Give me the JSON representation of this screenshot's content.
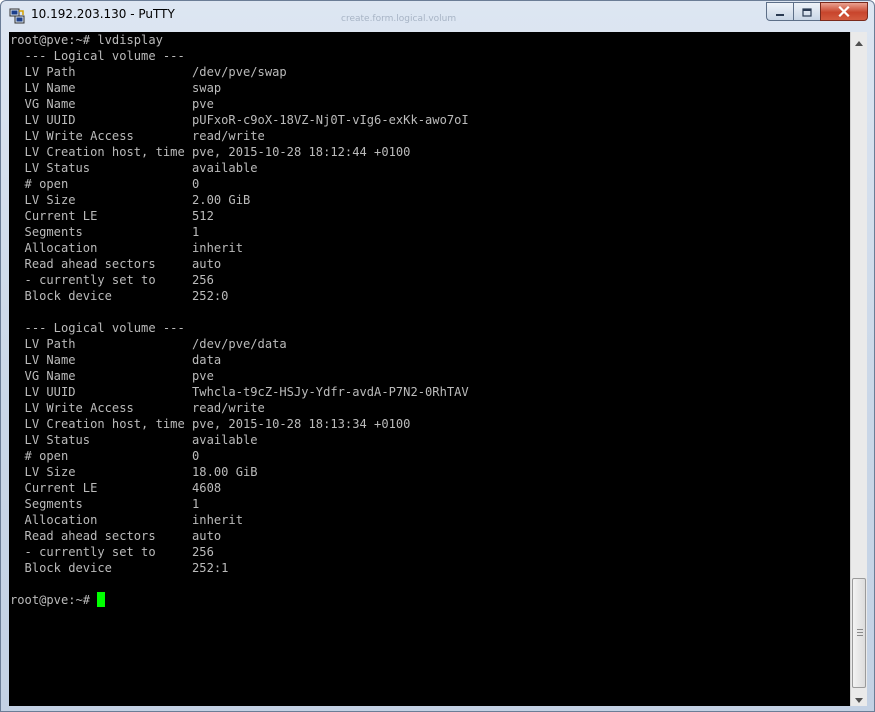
{
  "window": {
    "title": "10.192.203.130 - PuTTY",
    "app_icon": "putty-icon",
    "background_hint": "create.form.logical.volum",
    "controls": {
      "minimize_icon": "minimize-icon",
      "maximize_icon": "maximize-icon",
      "close_icon": "close-icon"
    }
  },
  "terminal": {
    "lines": [
      "root@pve:~# lvdisplay",
      "  --- Logical volume ---",
      "  LV Path                /dev/pve/swap",
      "  LV Name                swap",
      "  VG Name                pve",
      "  LV UUID                pUFxoR-c9oX-18VZ-Nj0T-vIg6-exKk-awo7oI",
      "  LV Write Access        read/write",
      "  LV Creation host, time pve, 2015-10-28 18:12:44 +0100",
      "  LV Status              available",
      "  # open                 0",
      "  LV Size                2.00 GiB",
      "  Current LE             512",
      "  Segments               1",
      "  Allocation             inherit",
      "  Read ahead sectors     auto",
      "  - currently set to     256",
      "  Block device           252:0",
      "",
      "  --- Logical volume ---",
      "  LV Path                /dev/pve/data",
      "  LV Name                data",
      "  VG Name                pve",
      "  LV UUID                Twhcla-t9cZ-HSJy-Ydfr-avdA-P7N2-0RhTAV",
      "  LV Write Access        read/write",
      "  LV Creation host, time pve, 2015-10-28 18:13:34 +0100",
      "  LV Status              available",
      "  # open                 0",
      "  LV Size                18.00 GiB",
      "  Current LE             4608",
      "  Segments               1",
      "  Allocation             inherit",
      "  Read ahead sectors     auto",
      "  - currently set to     256",
      "  Block device           252:1"
    ],
    "prompt": "root@pve:~# ",
    "colors": {
      "background": "#000000",
      "foreground": "#bbbbbb",
      "cursor": "#00ff00"
    }
  },
  "scrollbar": {
    "up_icon": "scroll-up-arrow-icon",
    "down_icon": "scroll-down-arrow-icon"
  }
}
